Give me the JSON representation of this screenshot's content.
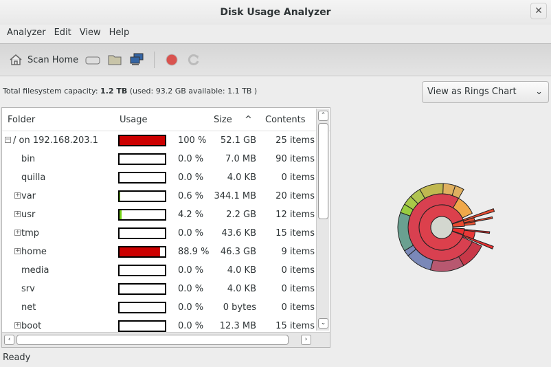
{
  "window": {
    "title": "Disk Usage Analyzer"
  },
  "menu": [
    "Analyzer",
    "Edit",
    "View",
    "Help"
  ],
  "toolbar": {
    "scan_home": "Scan Home"
  },
  "capacity": {
    "prefix": "Total filesystem capacity: ",
    "total": "1.2 TB",
    "suffix": " (used: 93.2 GB available: 1.1 TB )"
  },
  "view_select": {
    "value": "View as Rings Chart"
  },
  "columns": {
    "folder": "Folder",
    "usage": "Usage",
    "size": "Size",
    "contents": "Contents"
  },
  "rows": [
    {
      "name": "/ on 192.168.203.1",
      "pct": "100 %",
      "fill": 100,
      "size": "52.1 GB",
      "contents": "25 items",
      "expander": "minus",
      "indent": 0,
      "color": "#cc0000"
    },
    {
      "name": "bin",
      "pct": "0.0 %",
      "fill": 0,
      "size": "7.0 MB",
      "contents": "90 items",
      "expander": "",
      "indent": 1,
      "color": "#cc0000"
    },
    {
      "name": "quilla",
      "pct": "0.0 %",
      "fill": 0,
      "size": "4.0 KB",
      "contents": "0 items",
      "expander": "",
      "indent": 1,
      "color": "#cc0000"
    },
    {
      "name": "var",
      "pct": "0.6 %",
      "fill": 0.6,
      "size": "344.1 MB",
      "contents": "20 items",
      "expander": "plus",
      "indent": 1,
      "color": "#73d216"
    },
    {
      "name": "usr",
      "pct": "4.2 %",
      "fill": 4.2,
      "size": "2.2 GB",
      "contents": "12 items",
      "expander": "plus",
      "indent": 1,
      "color": "#73d216"
    },
    {
      "name": "tmp",
      "pct": "0.0 %",
      "fill": 0,
      "size": "43.6 KB",
      "contents": "15 items",
      "expander": "plus",
      "indent": 1,
      "color": "#cc0000"
    },
    {
      "name": "home",
      "pct": "88.9 %",
      "fill": 88.9,
      "size": "46.3 GB",
      "contents": "9 items",
      "expander": "plus",
      "indent": 1,
      "color": "#cc0000"
    },
    {
      "name": "media",
      "pct": "0.0 %",
      "fill": 0,
      "size": "4.0 KB",
      "contents": "0 items",
      "expander": "",
      "indent": 1,
      "color": "#cc0000"
    },
    {
      "name": "srv",
      "pct": "0.0 %",
      "fill": 0,
      "size": "4.0 KB",
      "contents": "0 items",
      "expander": "",
      "indent": 1,
      "color": "#cc0000"
    },
    {
      "name": "net",
      "pct": "0.0 %",
      "fill": 0,
      "size": "0 bytes",
      "contents": "0 items",
      "expander": "",
      "indent": 1,
      "color": "#cc0000"
    },
    {
      "name": "boot",
      "pct": "0.0 %",
      "fill": 0,
      "size": "12.3 MB",
      "contents": "15 items",
      "expander": "plus",
      "indent": 1,
      "color": "#cc0000"
    }
  ],
  "status": "Ready"
}
